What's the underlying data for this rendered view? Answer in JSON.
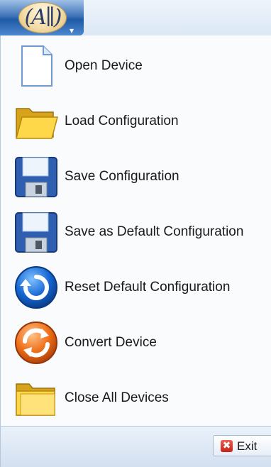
{
  "app_button": {
    "logo_text": "(A∥)",
    "dropdown_glyph": "▾"
  },
  "menu": {
    "items": [
      {
        "label": "Open Device",
        "icon": "document-icon"
      },
      {
        "label": "Load Configuration",
        "icon": "folder-open-icon"
      },
      {
        "label": "Save Configuration",
        "icon": "floppy-disk-icon"
      },
      {
        "label": "Save as Default Configuration",
        "icon": "floppy-disk-icon"
      },
      {
        "label": "Reset Default Configuration",
        "icon": "reset-icon"
      },
      {
        "label": "Convert Device",
        "icon": "convert-icon"
      },
      {
        "label": "Close All Devices",
        "icon": "folder-icon"
      }
    ]
  },
  "footer": {
    "exit_label": "Exit",
    "exit_icon_glyph": "✖"
  }
}
